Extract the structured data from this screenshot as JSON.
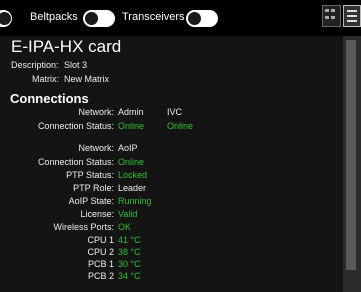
{
  "toolbar": {
    "beltpacks_label": "Beltpacks",
    "transceivers_label": "Transceivers"
  },
  "card": {
    "title": "E-IPA-HX card",
    "description_label": "Description:",
    "description_value": "Slot 3",
    "matrix_label": "Matrix:",
    "matrix_value": "New Matrix"
  },
  "connections": {
    "heading": "Connections",
    "network_label": "Network:",
    "net_admin": "Admin",
    "net_ivc": "IVC",
    "status_label": "Connection Status:",
    "status_admin": "Online",
    "status_ivc": "Online",
    "network2_label": "Network:",
    "net_aoip": "AoIP",
    "status2_label": "Connection Status:",
    "status_aoip": "Online",
    "ptp_status_label": "PTP Status:",
    "ptp_status": "Locked",
    "ptp_role_label": "PTP Role:",
    "ptp_role": "Leader",
    "aoip_state_label": "AoIP State:",
    "aoip_state": "Running",
    "license_label": "License:",
    "license": "Valid",
    "wireless_label": "Wireless Ports:",
    "wireless": "OK",
    "cpu1_label": "CPU 1",
    "cpu1": "41 °C",
    "cpu2_label": "CPU 2",
    "cpu2": "38 °C",
    "pcb1_label": "PCB 1",
    "pcb1": "30 °C",
    "pcb2_label": "PCB 2",
    "pcb2": "34 °C"
  },
  "colors": {
    "online": "#2fbf2f",
    "background": "#141414"
  }
}
